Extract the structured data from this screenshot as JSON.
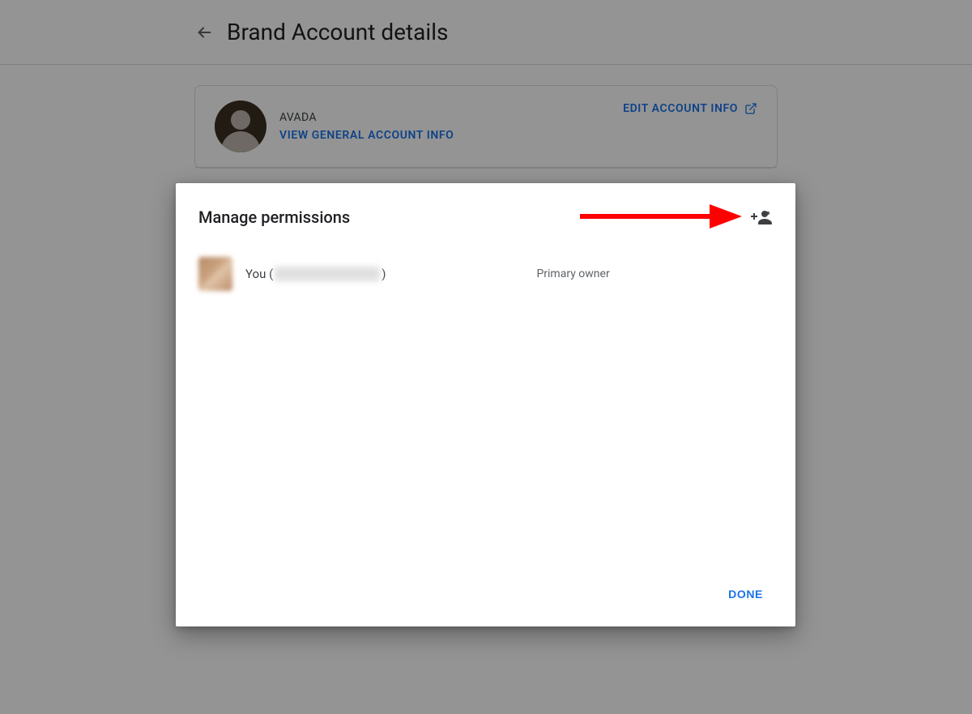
{
  "header": {
    "page_title": "Brand Account details"
  },
  "account": {
    "name": "AVADA",
    "view_link": "VIEW GENERAL ACCOUNT INFO",
    "edit_link": "EDIT ACCOUNT INFO"
  },
  "dialog": {
    "title": "Manage permissions",
    "done_label": "DONE"
  },
  "permissions": [
    {
      "name_prefix": "You (",
      "name_suffix": ")",
      "role": "Primary owner"
    }
  ],
  "icons": {
    "back": "arrow-back-icon",
    "launch": "open-in-new-icon",
    "add_people": "person-add-icon"
  },
  "colors": {
    "link": "#1a73e8",
    "text": "#202124",
    "muted": "#5f6368",
    "border": "#dadce0",
    "arrow": "#ff0000"
  }
}
